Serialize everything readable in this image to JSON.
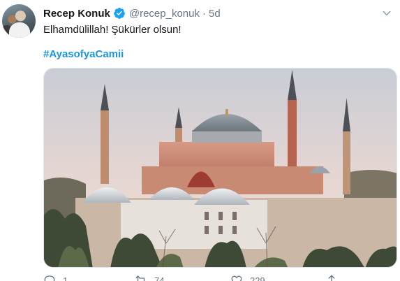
{
  "tweet": {
    "display_name": "Recep Konuk",
    "handle": "@recep_konuk",
    "separator": "·",
    "timestamp": "5d",
    "text": "Elhamdülillah! Şükürler olsun!",
    "hashtag": "#AyasofyaCamii"
  },
  "actions": {
    "reply_count": "1",
    "retweet_count": "74",
    "like_count": "229"
  },
  "icons": {
    "verified": "verified-badge-icon",
    "caret": "chevron-down-icon",
    "reply": "reply-icon",
    "retweet": "retweet-icon",
    "like": "heart-icon",
    "share": "share-icon"
  },
  "colors": {
    "verified": "#1da1f2",
    "hashtag": "#1b95e0",
    "secondary_text": "#657786",
    "primary_text": "#14171a"
  }
}
